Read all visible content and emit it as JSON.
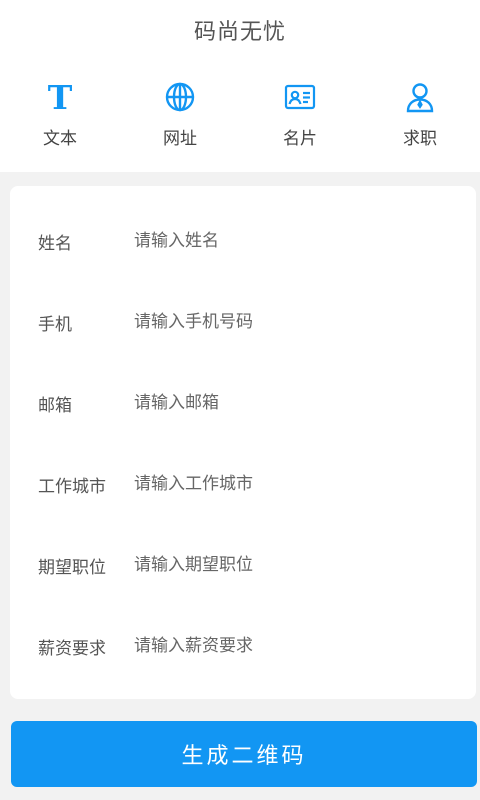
{
  "app": {
    "title": "码尚无忧"
  },
  "tabs": [
    {
      "label": "文本",
      "icon": "text-icon"
    },
    {
      "label": "网址",
      "icon": "globe-icon"
    },
    {
      "label": "名片",
      "icon": "business-card-icon"
    },
    {
      "label": "求职",
      "icon": "job-seeker-icon"
    }
  ],
  "form": {
    "fields": [
      {
        "label": "姓名",
        "placeholder": "请输入姓名"
      },
      {
        "label": "手机",
        "placeholder": "请输入手机号码"
      },
      {
        "label": "邮箱",
        "placeholder": "请输入邮箱"
      },
      {
        "label": "工作城市",
        "placeholder": "请输入工作城市"
      },
      {
        "label": "期望职位",
        "placeholder": "请输入期望职位"
      },
      {
        "label": "薪资要求",
        "placeholder": "请输入薪资要求"
      }
    ]
  },
  "actions": {
    "generate_label": "生成二维码"
  },
  "colors": {
    "accent": "#1296f3",
    "background": "#f2f2f2",
    "card": "#ffffff"
  }
}
